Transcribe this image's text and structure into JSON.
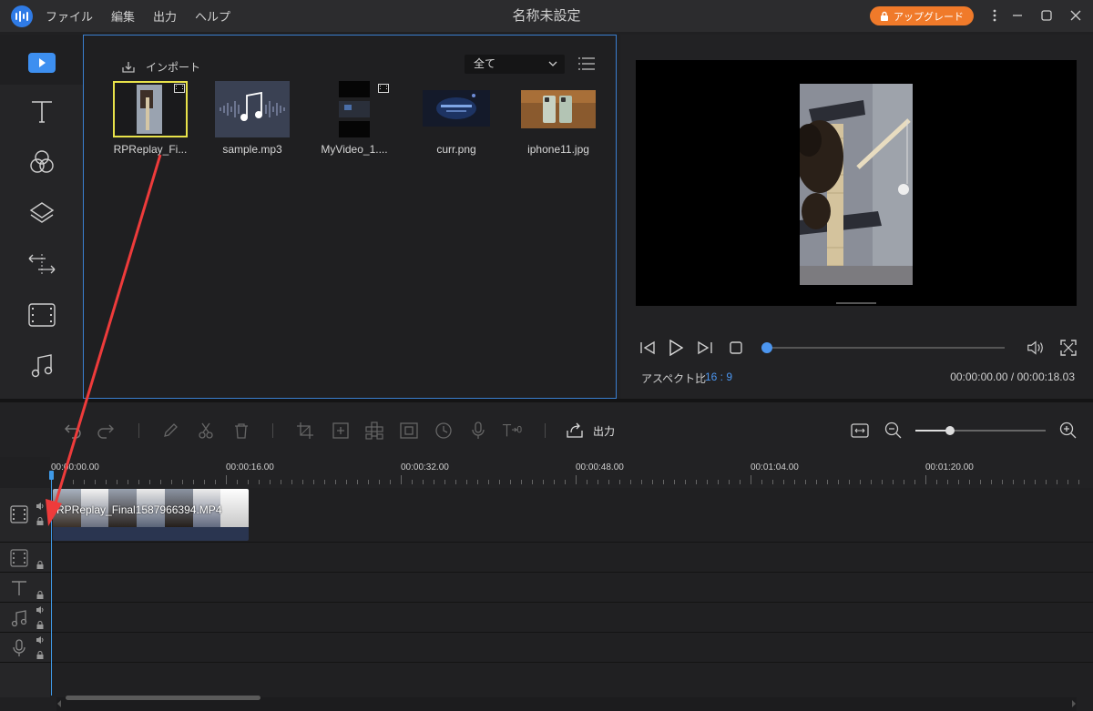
{
  "app": {
    "window_title": "名称未設定",
    "menu": [
      "ファイル",
      "編集",
      "出力",
      "ヘルプ"
    ],
    "upgrade_label": "アップグレード"
  },
  "media": {
    "import_label": "インポート",
    "filter_value": "全て",
    "items": [
      {
        "name": "RPReplay_Fi...",
        "type": "video"
      },
      {
        "name": "sample.mp3",
        "type": "audio"
      },
      {
        "name": "MyVideo_1....",
        "type": "video"
      },
      {
        "name": "curr.png",
        "type": "image"
      },
      {
        "name": "iphone11.jpg",
        "type": "image"
      }
    ]
  },
  "preview": {
    "aspect_label": "アスペクト比",
    "aspect_value": "16 : 9",
    "time": "00:00:00.00 / 00:00:18.03"
  },
  "toolbar": {
    "export_label": "出力"
  },
  "timeline": {
    "ticks": [
      "00:00:00.00",
      "00:00:16.00",
      "00:00:32.00",
      "00:00:48.00",
      "00:01:04.00",
      "00:01:20.00"
    ],
    "clip_label": "RPReplay_Final1587966394.MP4"
  },
  "colors": {
    "accent": "#3f9ae8",
    "upgrade": "#f07a2a",
    "annotation_arrow": "#ee3b3b"
  }
}
